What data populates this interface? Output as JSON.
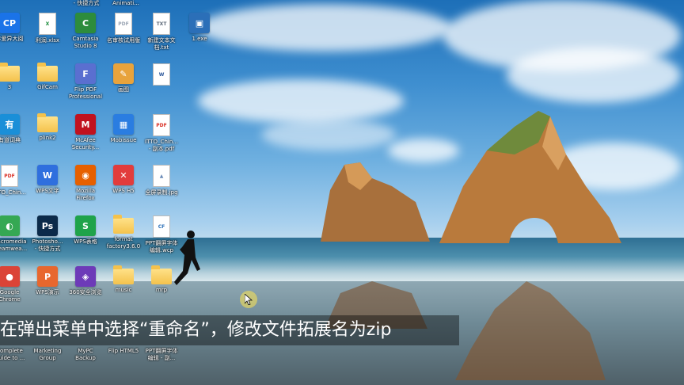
{
  "desktop": {
    "top_labels": [
      "- 快捷方式",
      "Animati..."
    ],
    "icons": [
      {
        "label": "珍爱异大阅",
        "kind": "cp",
        "color": "#1a73e8",
        "glyph": "CP"
      },
      {
        "label": "利润.xlsx",
        "kind": "doc",
        "color": "#1e8e3e",
        "glyph": "X"
      },
      {
        "label": "Camtasia\nStudio 8",
        "kind": "app",
        "color": "#2d8c3c",
        "glyph": "C"
      },
      {
        "label": "名审核试用版",
        "kind": "pdf",
        "color": "#9aa4b3",
        "glyph": "PDF"
      },
      {
        "label": "新建文本文\n档.txt",
        "kind": "doc",
        "color": "#5f6b7a",
        "glyph": "TXT"
      },
      {
        "label": "1.exe",
        "kind": "app",
        "color": "#2b6fb8",
        "glyph": "▣"
      },
      {
        "label": "3",
        "kind": "folder",
        "color": "#f4c24c",
        "glyph": ""
      },
      {
        "label": "GifCam",
        "kind": "folder",
        "color": "#f4c24c",
        "glyph": ""
      },
      {
        "label": "Flip PDF\nProfessional",
        "kind": "app",
        "color": "#5a6fd0",
        "glyph": "F"
      },
      {
        "label": "画图",
        "kind": "app",
        "color": "#e8a33c",
        "glyph": "✎"
      },
      {
        "label": "",
        "kind": "doc",
        "color": "#2b579a",
        "glyph": "W"
      },
      {
        "label": "有道词典",
        "kind": "app",
        "color": "#1a8fd8",
        "glyph": "有"
      },
      {
        "label": "plink2",
        "kind": "folder",
        "color": "#f4c24c",
        "glyph": ""
      },
      {
        "label": "McAfee\nSecurity...",
        "kind": "app",
        "color": "#c1121f",
        "glyph": "M"
      },
      {
        "label": "Mobissue",
        "kind": "app",
        "color": "#2a7de1",
        "glyph": "▦"
      },
      {
        "label": "ITTO_Chin...\n- 副本.pdf",
        "kind": "pdf",
        "color": "#d93025",
        "glyph": "PDF"
      },
      {
        "label": "ITTO_Chin...",
        "kind": "pdf",
        "color": "#d93025",
        "glyph": "PDF"
      },
      {
        "label": "WPS文字",
        "kind": "app",
        "color": "#2f6fde",
        "glyph": "W"
      },
      {
        "label": "Mozilla\nFirefox",
        "kind": "app",
        "color": "#e66000",
        "glyph": "◉"
      },
      {
        "label": "WPS H5",
        "kind": "app",
        "color": "#e23c3c",
        "glyph": "✕"
      },
      {
        "label": "全屏录制.jpg",
        "kind": "doc",
        "color": "#6a8bb8",
        "glyph": "▲"
      },
      {
        "label": "Macromedia\nDreamwea...",
        "kind": "app",
        "color": "#35a853",
        "glyph": "◐"
      },
      {
        "label": "Photosho...\n- 快捷方式",
        "kind": "app",
        "color": "#0b2a4a",
        "glyph": "Ps"
      },
      {
        "label": "WPS表格",
        "kind": "app",
        "color": "#1fa34a",
        "glyph": "S"
      },
      {
        "label": "format\nfactory3.6.0",
        "kind": "folder",
        "color": "#f4c24c",
        "glyph": ""
      },
      {
        "label": "PPT翻屏字体\n编辑.wcp",
        "kind": "doc",
        "color": "#2b6fb8",
        "glyph": "CF"
      },
      {
        "label": "Google\nChrome",
        "kind": "app",
        "color": "#db4437",
        "glyph": "●"
      },
      {
        "label": "WPS演示",
        "kind": "app",
        "color": "#e8672e",
        "glyph": "P"
      },
      {
        "label": "360安全浏览",
        "kind": "app",
        "color": "#6d3ab8",
        "glyph": "◈"
      },
      {
        "label": "music",
        "kind": "folder",
        "color": "#f4c24c",
        "glyph": ""
      },
      {
        "label": "mrp",
        "kind": "folder",
        "color": "#f4c24c",
        "glyph": ""
      }
    ],
    "bottom_labels": [
      {
        "label": "Complete\nGuide to ..."
      },
      {
        "label": "Marketing\nGroup"
      },
      {
        "label": "MyPC\nBackup"
      },
      {
        "label": "Flip HTML5"
      },
      {
        "label": "PPT翻屏字体\n编辑 - 副..."
      }
    ],
    "subtitle": "在弹出菜单中选择“重命名”，修改文件拓展名为zip"
  }
}
